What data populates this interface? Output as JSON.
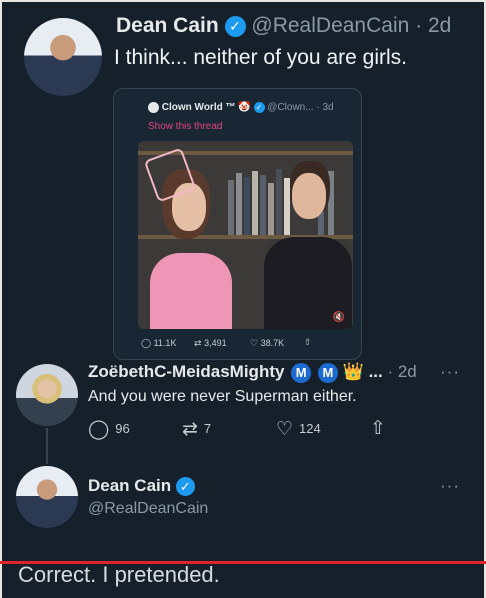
{
  "tweet1": {
    "name": "Dean Cain",
    "handle": "@RealDeanCain",
    "time": "· 2d",
    "text": "I think... neither of you are girls."
  },
  "quote": {
    "name": "Clown World ™",
    "handle": "@Clown... · 3d",
    "show_thread": "Show this thread",
    "stats": {
      "replies": "11.1K",
      "retweets": "3,491",
      "likes": "38.7K"
    },
    "colors": {
      "link": "#e0457b"
    }
  },
  "reply": {
    "name": "ZoëbethC-MeidasMighty",
    "badge1": "M",
    "badge2": "M",
    "truncation": "...",
    "time": "· 2d",
    "text": "And you were never Superman either.",
    "actions": {
      "replies": "96",
      "retweets": "7",
      "likes": "124"
    }
  },
  "tweet2": {
    "name": "Dean Cain",
    "handle": "@RealDeanCain",
    "text": "Correct. I pretended."
  },
  "icons": {
    "verified": "verified-icon",
    "reply": "reply-icon",
    "retweet": "retweet-icon",
    "like": "heart-icon",
    "share": "share-icon",
    "more": "more-icon",
    "crown": "crown-icon"
  },
  "colors": {
    "background": "#15202b",
    "accent": "#1d9bf0",
    "divider": "#e0242b"
  }
}
